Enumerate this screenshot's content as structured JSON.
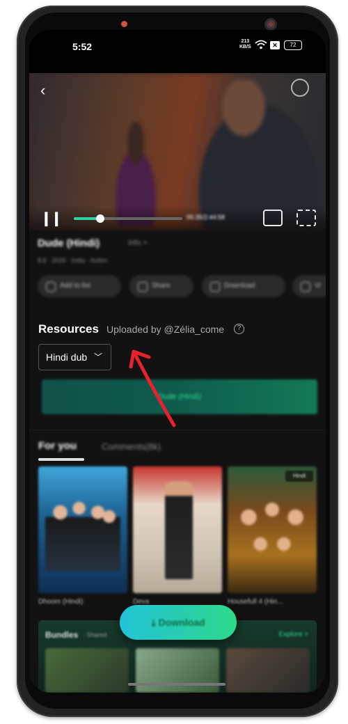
{
  "status_bar": {
    "time": "5:52",
    "net_speed_value": "213",
    "net_speed_unit": "KB/S",
    "battery": "72"
  },
  "player": {
    "back_icon": "back-arrow-icon",
    "timecode": "05:35/2:44:58"
  },
  "movie": {
    "title": "Dude (Hindi)",
    "info_link": "Info >",
    "meta": "8.8 · 2025 · India · Action",
    "rating": "8.8",
    "actions": [
      "Add to list",
      "Share",
      "Download",
      "Vi"
    ]
  },
  "resources": {
    "heading": "Resources",
    "uploaded_by": "Uploaded by @Zélia_come",
    "help_icon": "?",
    "language_selected": "Hindi dub",
    "resource_item": "Dude (Hindi)"
  },
  "tabs": {
    "for_you": "For you",
    "comments": "Comments(8k)"
  },
  "recommendations": [
    {
      "title": "Dhoom (Hindi)"
    },
    {
      "title": "Deva"
    },
    {
      "title": "Housefull 4 (Hin..."
    }
  ],
  "recommendation_tag": "Hindi",
  "bundles": {
    "title": "Bundles",
    "subtitle": "· Shared",
    "explore": "Explore >"
  },
  "download_fab": "⤓ Download",
  "colors": {
    "accent_green": "#2ed58c",
    "annotation_red": "#e8222c",
    "background": "#121212"
  }
}
